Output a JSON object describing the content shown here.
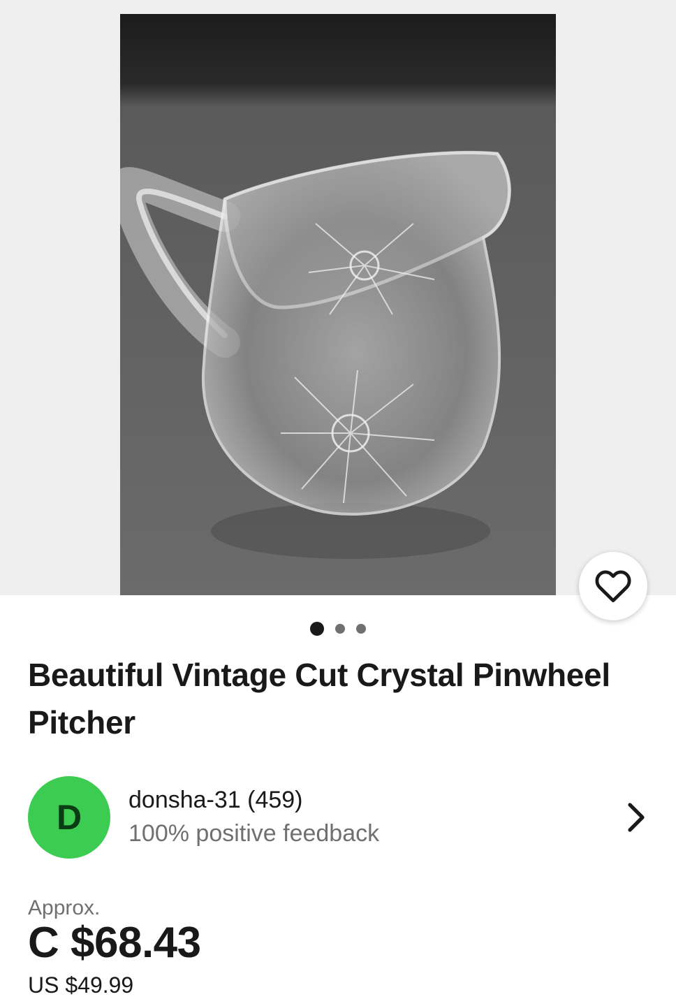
{
  "gallery": {
    "image_alt": "Crystal pinwheel pitcher photo",
    "current_index": 1,
    "total_images": 3
  },
  "favorite": {
    "icon": "heart-outline-icon"
  },
  "listing": {
    "title": "Beautiful Vintage Cut Crystal Pinwheel Pitcher"
  },
  "seller": {
    "avatar_letter": "D",
    "avatar_color": "#3ccc51",
    "name": "donsha-31 (459)",
    "feedback": "100% positive feedback",
    "chevron_icon": "chevron-right-icon"
  },
  "price": {
    "approx_label": "Approx.",
    "converted": "C $68.43",
    "original": "US $49.99"
  }
}
